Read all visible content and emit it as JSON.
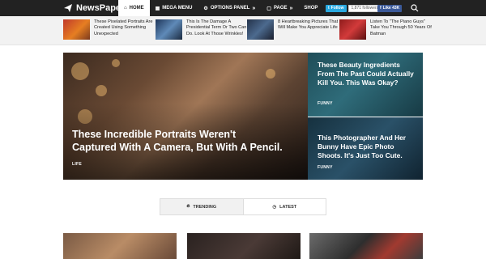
{
  "header": {
    "logo_text": "NewsPaper",
    "nav": [
      {
        "label": "HOME",
        "icon": "home-icon",
        "active": true
      },
      {
        "label": "MEGA MENU",
        "icon": "grid-icon"
      },
      {
        "label": "OPTIONS PANEL",
        "icon": "gear-icon",
        "chevron": "»"
      },
      {
        "label": "PAGE",
        "icon": "page-icon",
        "chevron": "»"
      },
      {
        "label": "SHOP"
      }
    ],
    "social": {
      "twitter_label": "Follow",
      "twitter_count": "1,871 followers",
      "facebook_label": "Like 43K"
    },
    "search_icon": "search-icon"
  },
  "ticker": [
    {
      "text": "These Pixelated Portraits Are Created Using Something Unexpected",
      "thumb": "food-thumb"
    },
    {
      "text": "This Is The Damage A Presidential Term Or Two Can Do. Look At Those Wrinkles!",
      "thumb": "car-thumb"
    },
    {
      "text": "8 Heartbreaking Pictures That Will Make You Appreciate Life",
      "thumb": "tech-thumb"
    },
    {
      "text": "Listen To \"The Piano Guys\" Take You Through 50 Years Of Batman",
      "thumb": "red-thumb"
    }
  ],
  "hero": {
    "main_title": "These Incredible Portraits Weren't Captured With A Camera, But With A Pencil.",
    "main_category": "LIFE",
    "side": [
      {
        "title": "These Beauty Ingredients From The Past Could Actually Kill You. This Was Okay?",
        "category": "FUNNY"
      },
      {
        "title": "This Photographer And Her Bunny Have Epic Photo Shoots. It's Just Too Cute.",
        "category": "FUNNY"
      }
    ]
  },
  "tabs": [
    {
      "label": "TRENDING",
      "icon": "fire-icon",
      "active": true
    },
    {
      "label": "LATEST",
      "icon": "clock-icon"
    }
  ],
  "colors": {
    "nav_bg": "#222222",
    "twitter": "#29a9e0",
    "facebook": "#3b5998"
  }
}
